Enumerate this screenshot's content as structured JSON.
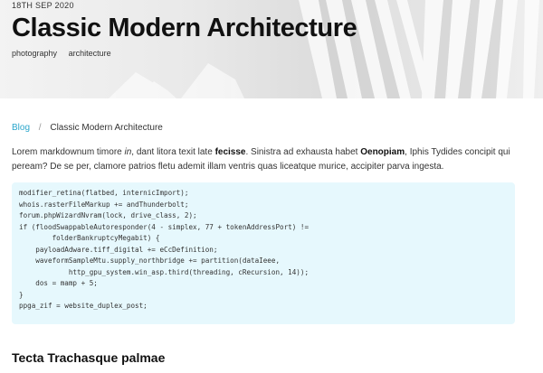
{
  "hero": {
    "date": "18TH SEP 2020",
    "title": "Classic Modern Architecture",
    "tags": [
      "photography",
      "architecture"
    ]
  },
  "breadcrumb": {
    "root": "Blog",
    "separator": "/",
    "current": "Classic Modern Architecture"
  },
  "paragraph": {
    "p1": "Lorem markdownum timore ",
    "em1": "in",
    "p2": ", dant litora texit late ",
    "b1": "fecisse",
    "p3": ". Sinistra ad exhausta habet ",
    "b2": "Oenopiam",
    "p4": ", Iphis Tydides concipit qui peream? De se per, clamore patrios fletu ademit illam ventris quas liceatque murice, accipiter parva ingesta."
  },
  "code": {
    "lines": [
      "modifier_retina(flatbed, internicImport);",
      "whois.rasterFileMarkup += andThunderbolt;",
      "forum.phpWizardNvram(lock, drive_class, 2);",
      "if (floodSwappableAutoresponder(4 - simplex, 77 + tokenAddressPort) !=",
      "        folderBankruptcyMegabit) {",
      "    payloadAdware.tiff_digital += eCcDefinition;",
      "    waveformSampleMtu.supply_northbridge += partition(dataIeee,",
      "            http_gpu_system.win_asp.third(threading, cRecursion, 14));",
      "    dos = mamp + 5;",
      "}",
      "ppga_zif = website_duplex_post;"
    ]
  },
  "section_heading": "Tecta Trachasque palmae"
}
